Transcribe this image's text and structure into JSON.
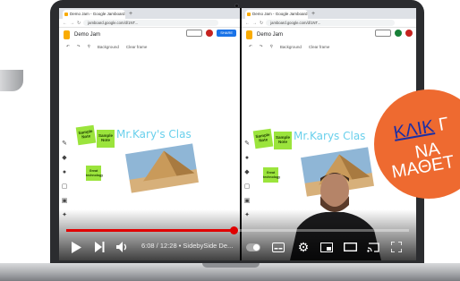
{
  "browser": {
    "tab_title": "Demo Jam - Google Jamboard",
    "tab_title_right": "Demo Jam - Google Jamboard",
    "url": "jamboard.google.com/d/1NT..."
  },
  "jamboard": {
    "doc_title": "Demo Jam",
    "share_label": "SHARE",
    "background_label": "Background",
    "clear_frame_label": "Clear frame"
  },
  "board": {
    "handwriting_left": "Mr.Kary's Clas",
    "handwriting_right": "Mr.Karys Clas",
    "sticky_notes": [
      {
        "text": "Sample Note"
      },
      {
        "text": "Sample Note"
      },
      {
        "text": "Great technology"
      },
      {
        "text": "Sample Note"
      },
      {
        "text": "Sample Note"
      },
      {
        "text": "Great technology"
      }
    ]
  },
  "player": {
    "time_display": "6:08 / 12:28 • SidebySide De...",
    "progress_fraction": 0.49,
    "accent_color": "#e00000"
  },
  "badge": {
    "line1_link": "ΚΛΙΚ",
    "line1_rest": " Γ",
    "line2": "ΝΑ",
    "line3": "ΜΑΘΕΤ",
    "color": "#ee6a30"
  },
  "icons": [
    "play-icon",
    "next-icon",
    "volume-icon",
    "pause-toggle-icon",
    "subtitles-icon",
    "settings-icon",
    "miniplayer-icon",
    "theater-icon",
    "cast-icon",
    "fullscreen-icon"
  ]
}
